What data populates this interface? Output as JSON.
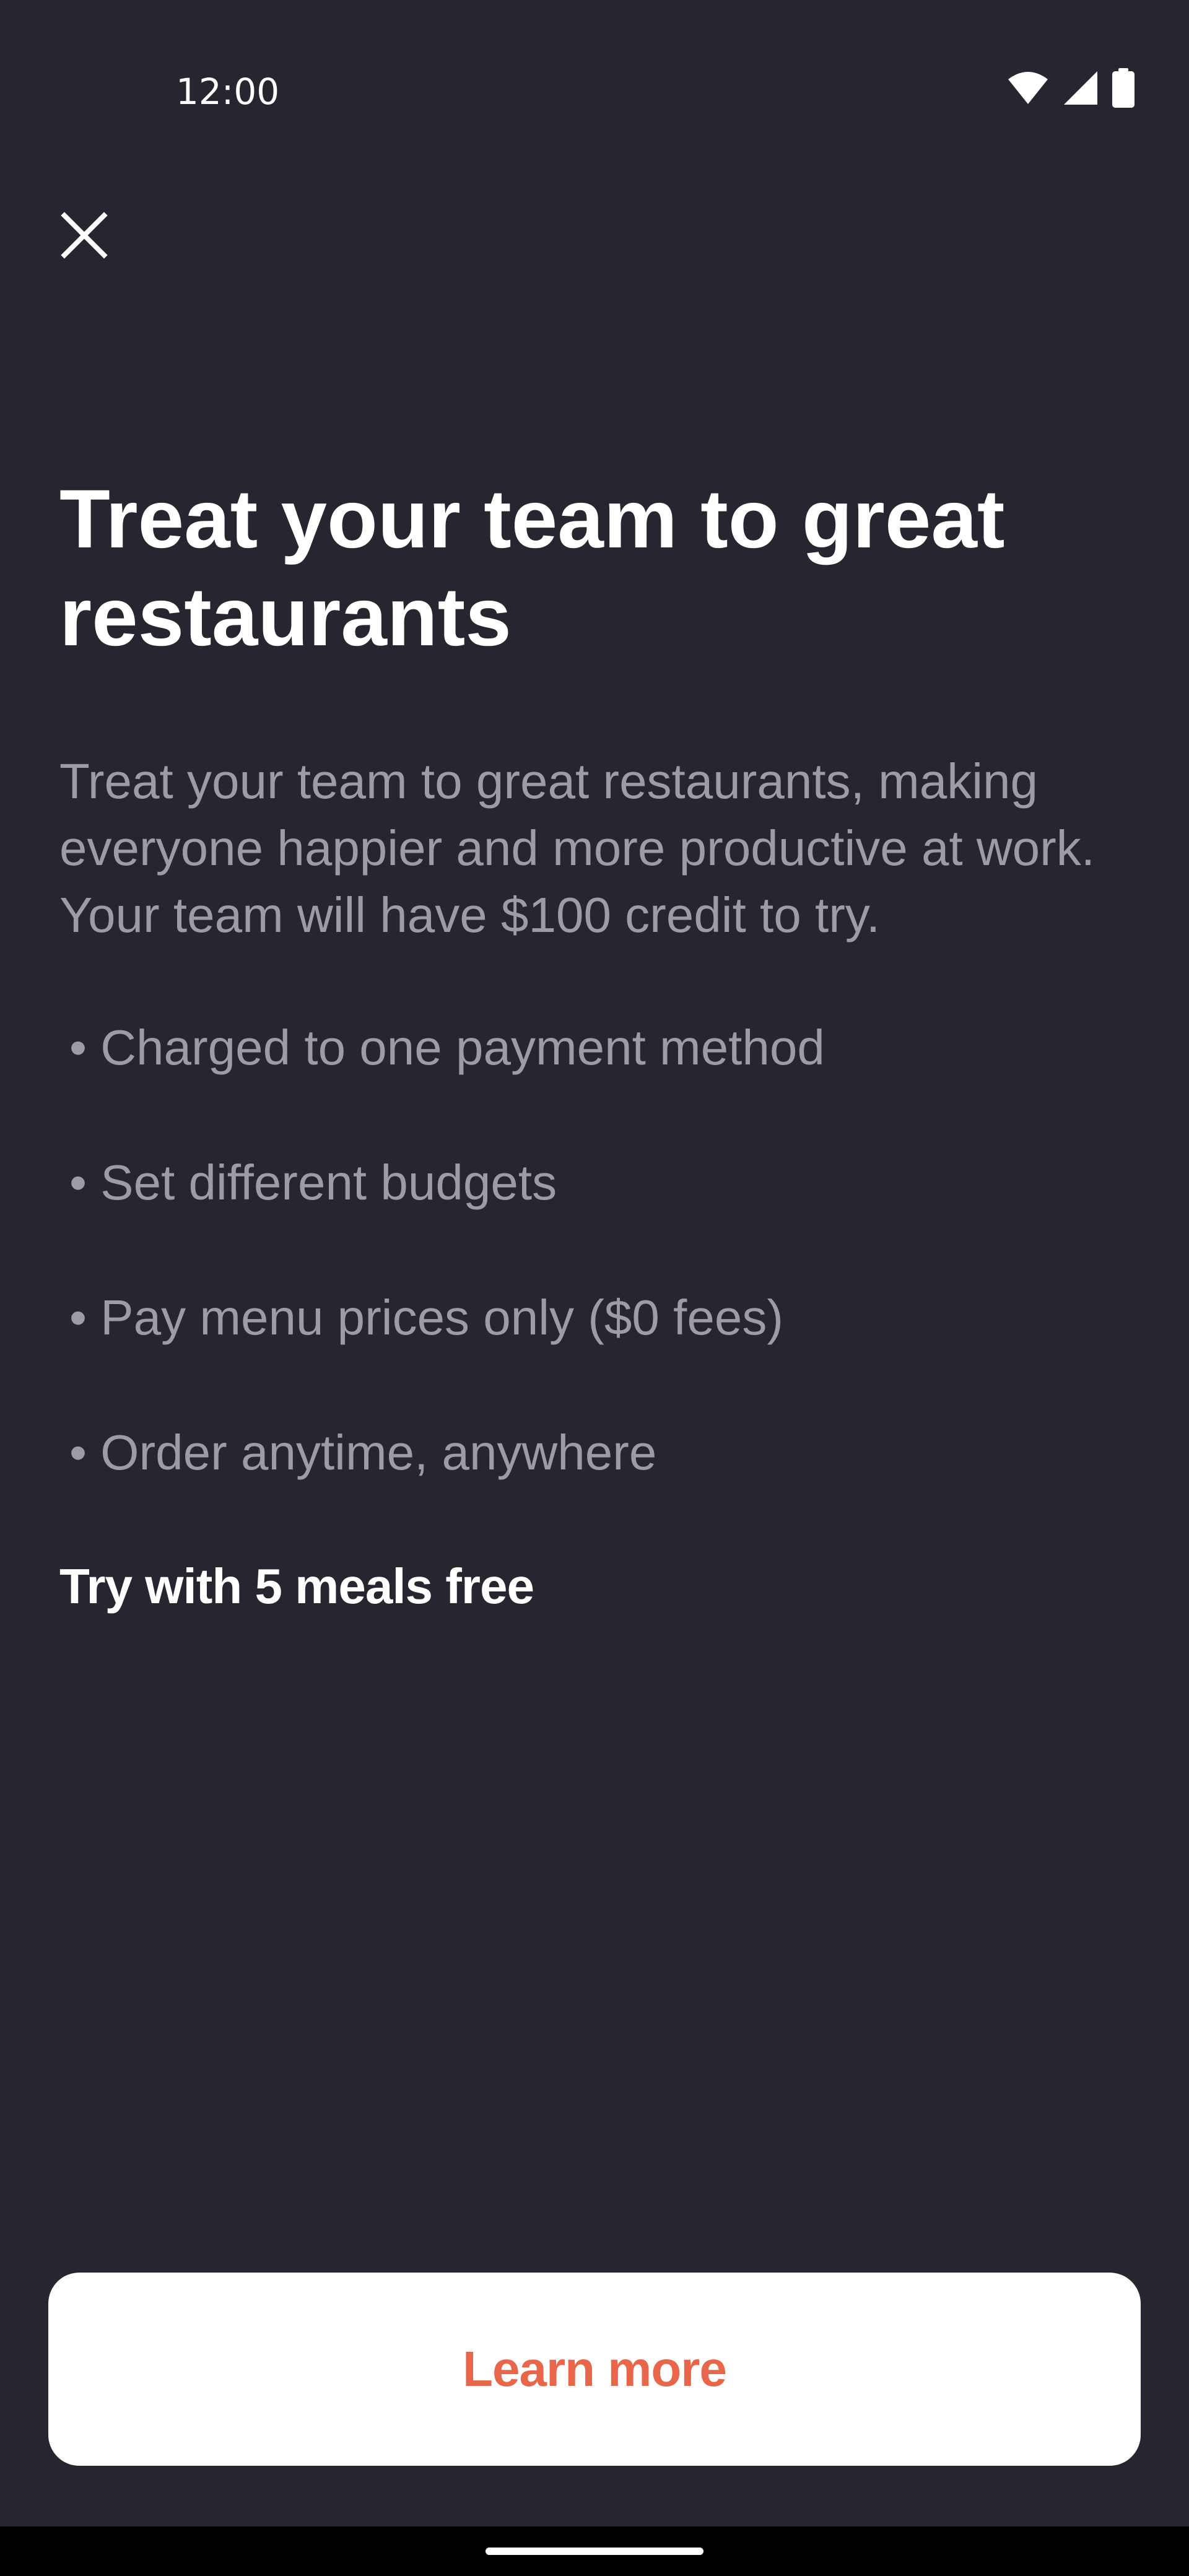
{
  "status_bar": {
    "time": "12:00",
    "icons": [
      "wifi-icon",
      "cellular-signal-icon",
      "battery-icon"
    ]
  },
  "close_button": {
    "icon": "close-icon"
  },
  "content": {
    "title": "Treat your team to great restaurants",
    "description": "Treat your team to great restaurants, making everyone happier and more productive at work. Your team will have $100 credit to try.",
    "bullets": [
      "• Charged to one payment method",
      "• Set different budgets",
      "• Pay menu prices only ($0 fees)",
      "• Order anytime, anywhere"
    ],
    "promo": "Try with 5 meals free"
  },
  "cta": {
    "label": "Learn more"
  },
  "colors": {
    "background": "#262630",
    "primary_text": "#ffffff",
    "secondary_text": "#9c9ca6",
    "accent": "#e8674a",
    "button_background": "#ffffff"
  }
}
